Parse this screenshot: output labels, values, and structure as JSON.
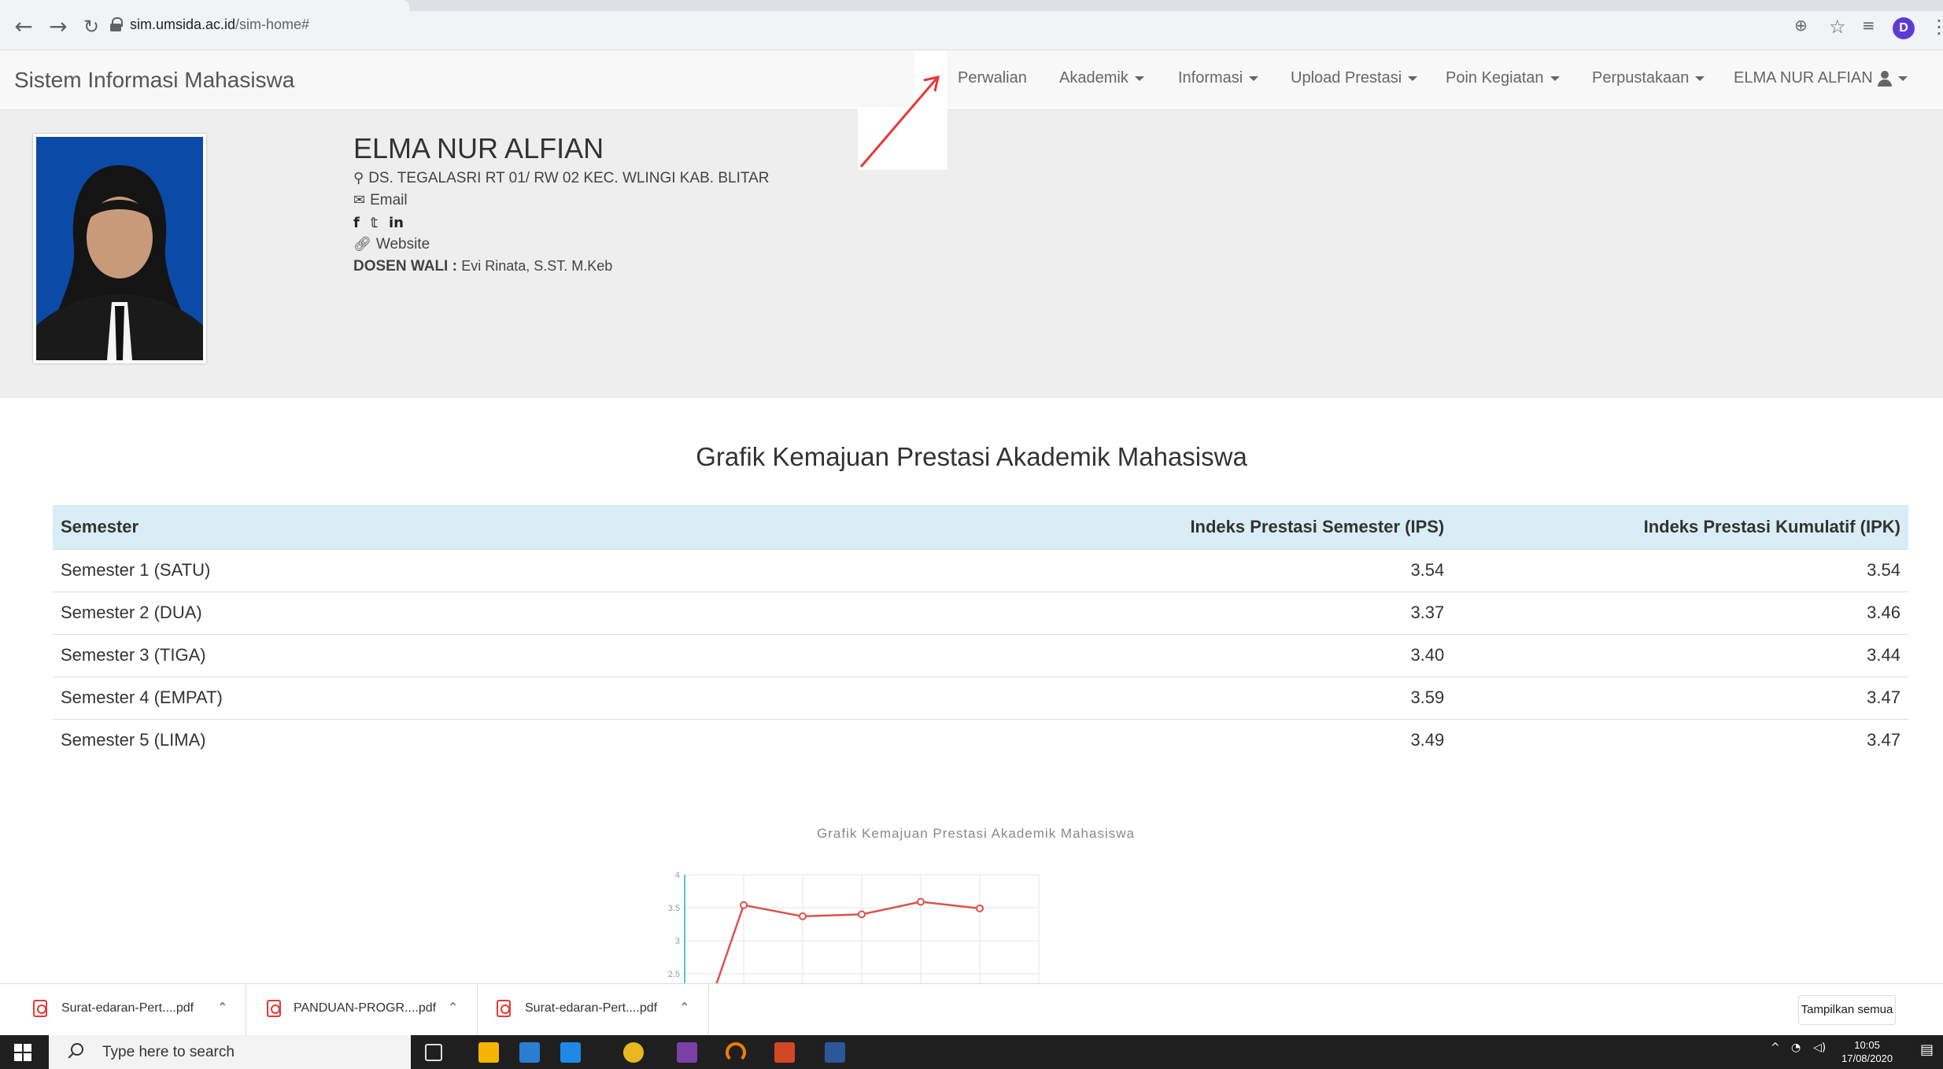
{
  "browser": {
    "url_host": "sim.umsida.ac.id",
    "url_path": "/sim-home#",
    "profile_initial": "D"
  },
  "navbar": {
    "brand": "Sistem Informasi Mahasiswa",
    "items": [
      {
        "label": "Perwalian",
        "dropdown": false
      },
      {
        "label": "Akademik",
        "dropdown": true
      },
      {
        "label": "Informasi",
        "dropdown": true
      },
      {
        "label": "Upload Prestasi",
        "dropdown": true
      },
      {
        "label": "Poin Kegiatan",
        "dropdown": true
      },
      {
        "label": "Perpustakaan",
        "dropdown": true
      }
    ],
    "user": "ELMA NUR ALFIAN",
    "colors": [
      "#e74c3c",
      "#f1c40f",
      "#2ecc71",
      "#9b59b6"
    ]
  },
  "profile": {
    "name": "ELMA NUR ALFIAN",
    "address": "DS. TEGALASRI RT 01/ RW 02 KEC. WLINGI KAB. BLITAR",
    "email_label": "Email",
    "social": [
      "f",
      "𝕥",
      "in"
    ],
    "website_label": "Website",
    "dosen_label": "DOSEN WALI :",
    "dosen_name": "Evi Rinata, S.ST. M.Keb"
  },
  "main": {
    "title": "Grafik Kemajuan Prestasi Akademik Mahasiswa",
    "table": {
      "headers": [
        "Semester",
        "Indeks Prestasi Semester (IPS)",
        "Indeks Prestasi Kumulatif (IPK)"
      ],
      "rows": [
        [
          "Semester 1 (SATU)",
          "3.54",
          "3.54"
        ],
        [
          "Semester 2 (DUA)",
          "3.37",
          "3.46"
        ],
        [
          "Semester 3 (TIGA)",
          "3.40",
          "3.44"
        ],
        [
          "Semester 4 (EMPAT)",
          "3.59",
          "3.47"
        ],
        [
          "Semester 5 (LIMA)",
          "3.49",
          "3.47"
        ]
      ]
    }
  },
  "chart_data": {
    "type": "line",
    "title": "Grafik Kemajuan Prestasi Akademik Mahasiswa",
    "x": [
      0,
      1,
      2,
      3,
      4,
      5
    ],
    "series": [
      {
        "values": [
          null,
          3.54,
          3.37,
          3.4,
          3.59,
          3.49
        ]
      }
    ],
    "yticks": [
      "4",
      "3.5",
      "3",
      "2.5"
    ],
    "ylim": [
      2.5,
      4
    ],
    "line_color": "#d9534f",
    "axis_color": "#5bc0de"
  },
  "downloads": {
    "items": [
      "Surat-edaran-Pert....pdf",
      "PANDUAN-PROGR....pdf",
      "Surat-edaran-Pert....pdf"
    ],
    "show_all": "Tampilkan semua"
  },
  "taskbar": {
    "search_placeholder": "Type here to search",
    "time": "10:05",
    "date": "17/08/2020"
  }
}
